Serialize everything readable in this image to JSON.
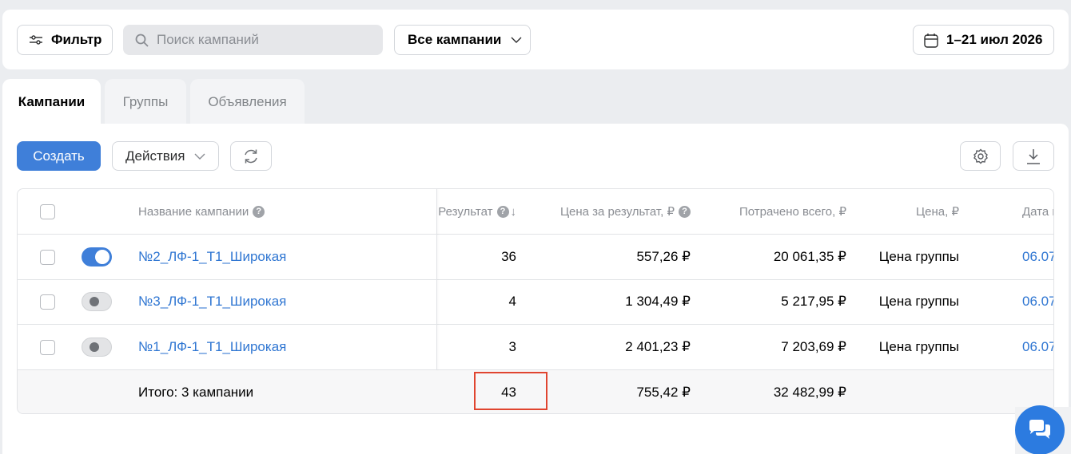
{
  "toolbar": {
    "filter_label": "Фильтр",
    "search_placeholder": "Поиск кампаний",
    "campaigns_select": "Все кампании",
    "date_range": "1–21 июл 2026"
  },
  "tabs": [
    {
      "label": "Кампании",
      "active": true
    },
    {
      "label": "Группы",
      "active": false
    },
    {
      "label": "Объявления",
      "active": false
    }
  ],
  "actions": {
    "create_label": "Создать",
    "actions_label": "Действия"
  },
  "table": {
    "headers": {
      "name": "Название кампании",
      "result": "Результат",
      "price_per_result": "Цена за результат, ₽",
      "spent_total": "Потрачено всего, ₽",
      "price": "Цена, ₽",
      "date": "Дата н"
    },
    "rows": [
      {
        "enabled": true,
        "name": "№2_ЛФ-1_Т1_Широкая",
        "result": "36",
        "price_per_result": "557,26 ₽",
        "spent_total": "20 061,35 ₽",
        "price": "Цена группы",
        "date": "06.07"
      },
      {
        "enabled": false,
        "name": "№3_ЛФ-1_Т1_Широкая",
        "result": "4",
        "price_per_result": "1 304,49 ₽",
        "spent_total": "5 217,95 ₽",
        "price": "Цена группы",
        "date": "06.07"
      },
      {
        "enabled": false,
        "name": "№1_ЛФ-1_Т1_Широкая",
        "result": "3",
        "price_per_result": "2 401,23 ₽",
        "spent_total": "7 203,69 ₽",
        "price": "Цена группы",
        "date": "06.07"
      }
    ],
    "total": {
      "label": "Итого: 3 кампании",
      "result": "43",
      "price_per_result": "755,42 ₽",
      "spent_total": "32 482,99 ₽"
    }
  },
  "colors": {
    "accent": "#3f7fd9",
    "link": "#2f76d2",
    "highlight": "#e04530"
  }
}
